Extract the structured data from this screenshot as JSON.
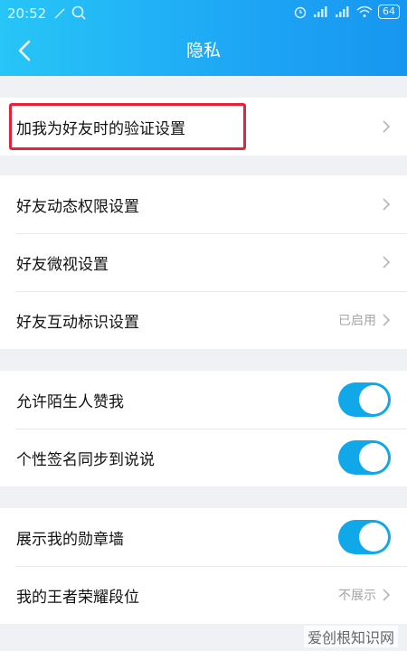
{
  "status_bar": {
    "time": "20:52",
    "battery": "64",
    "left_icons": [
      "nfc-icon",
      "search-icon"
    ],
    "right_icons": [
      "alarm-icon",
      "signal-icon",
      "signal-icon",
      "wifi-icon"
    ]
  },
  "header": {
    "title": "隐私",
    "back_icon": "chevron-left-icon"
  },
  "groups": [
    {
      "items": [
        {
          "label": "加我为好友时的验证设置"
        }
      ]
    },
    {
      "items": [
        {
          "label": "好友动态权限设置"
        },
        {
          "label": "好友微视设置"
        },
        {
          "label": "好友互动标识设置",
          "value": "已启用"
        }
      ]
    },
    {
      "items": [
        {
          "label": "允许陌生人赞我",
          "enabled": true
        },
        {
          "label": "个性签名同步到说说",
          "enabled": true
        }
      ]
    },
    {
      "items": [
        {
          "label": "展示我的勋章墙",
          "enabled": true
        },
        {
          "label": "我的王者荣耀段位",
          "value": "不展示"
        }
      ]
    }
  ],
  "colors": {
    "accent": "#1ea8f5",
    "toggle_on": "#10a8e8",
    "highlight": "#e5223a"
  },
  "watermark": "爱创根知识网"
}
